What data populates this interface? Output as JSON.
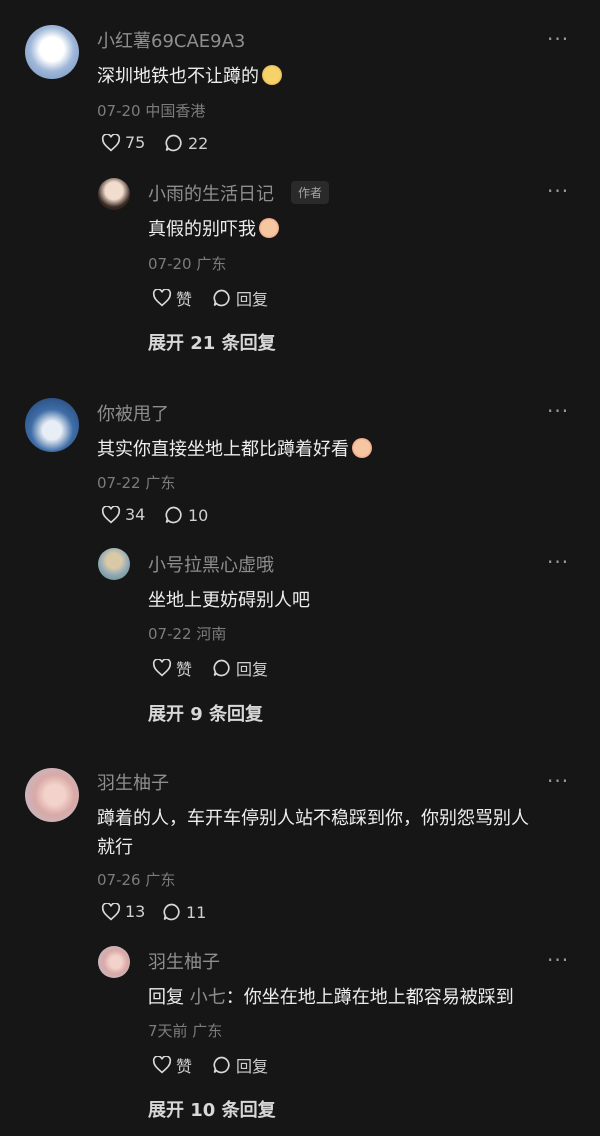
{
  "comments": [
    {
      "user": "小红薯69CAE9A3",
      "text": "深圳地铁也不让蹲的",
      "meta": "07-20 中国香港",
      "likes": "75",
      "replies_count": "22",
      "reply": {
        "user": "小雨的生活日记",
        "tag": "作者",
        "text": "真假的别吓我",
        "meta": "07-20 广东",
        "like_label": "赞",
        "reply_label": "回复"
      },
      "expand": "展开 21 条回复"
    },
    {
      "user": "你被甩了",
      "text": "其实你直接坐地上都比蹲着好看",
      "meta": "07-22 广东",
      "likes": "34",
      "replies_count": "10",
      "reply": {
        "user": "小号拉黑心虚哦",
        "text": "坐地上更妨碍别人吧",
        "meta": "07-22 河南",
        "like_label": "赞",
        "reply_label": "回复"
      },
      "expand": "展开 9 条回复"
    },
    {
      "user": "羽生柚子",
      "text_line1": "蹲着的人，车开车停别人站不稳踩到你，你别怨骂别人",
      "text_line2": "就行",
      "meta": "07-26 广东",
      "likes": "13",
      "replies_count": "11",
      "reply": {
        "user": "羽生柚子",
        "reply_prefix": "回复",
        "reply_to": "小七",
        "text": "：你坐在地上蹲在地上都容易被踩到",
        "meta": "7天前 广东",
        "like_label": "赞",
        "reply_label": "回复"
      },
      "expand": "展开 10 条回复"
    }
  ],
  "more_glyph": "···"
}
